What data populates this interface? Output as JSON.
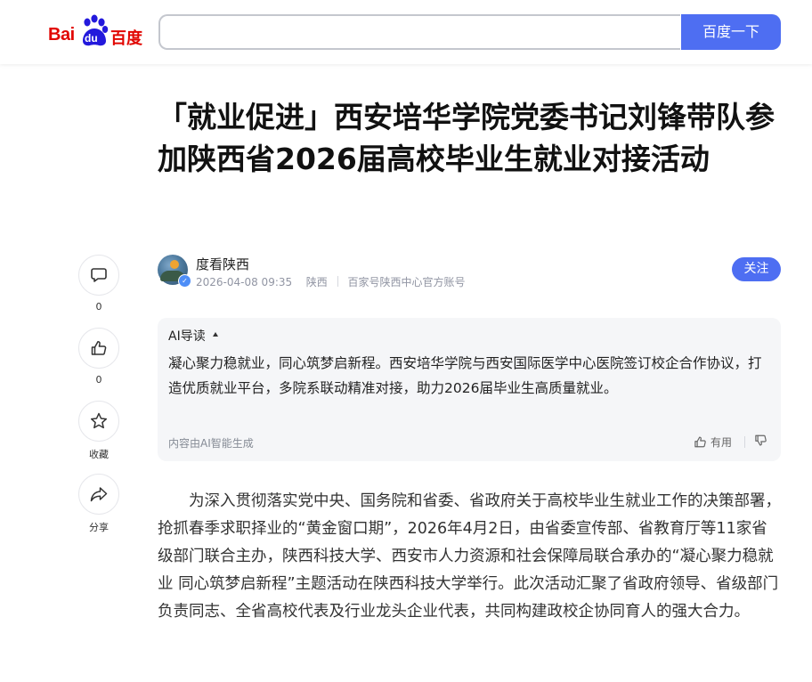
{
  "header": {
    "logo_bai": "Bai",
    "logo_du": "du",
    "logo_cn": "百度",
    "search_value": "",
    "search_button": "百度一下"
  },
  "article": {
    "title": "「就业促进」西安培华学院党委书记刘锋带队参加陕西省2026届高校毕业生就业对接活动",
    "author": {
      "name": "度看陕西",
      "datetime": "2026-04-08 09:35",
      "region": "陕西",
      "account_desc": "百家号陕西中心官方账号",
      "follow_label": "关注"
    },
    "body_paragraph": "为深入贯彻落实党中央、国务院和省委、省政府关于高校毕业生就业工作的决策部署，抢抓春季求职择业的“黄金窗口期”，2026年4月2日，由省委宣传部、省教育厅等11家省级部门联合主办，陕西科技大学、西安市人力资源和社会保障局联合承办的“凝心聚力稳就业 同心筑梦启新程”主题活动在陕西科技大学举行。此次活动汇聚了省政府领导、省级部门负责同志、全省高校代表及行业龙头企业代表，共同构建政校企协同育人的强大合力。"
  },
  "ai_summary": {
    "title": "AI导读",
    "text": "凝心聚力稳就业，同心筑梦启新程。西安培华学院与西安国际医学中心医院签订校企合作协议，打造优质就业平台，多院系联动精准对接，助力2026届毕业生高质量就业。",
    "footer": "内容由AI智能生成",
    "useful_label": "有用"
  },
  "sidebar": {
    "comment_count": "0",
    "like_count": "0",
    "favorite_label": "收藏",
    "share_label": "分享"
  },
  "colors": {
    "brand_red": "#e10601",
    "brand_blue": "#4e6ef2",
    "summary_bg": "#f5f6f8"
  },
  "icons": [
    "comment-icon",
    "thumbs-up-icon",
    "star-icon",
    "share-icon",
    "thumbs-down-icon",
    "verified-badge-icon",
    "caret-up-icon"
  ]
}
